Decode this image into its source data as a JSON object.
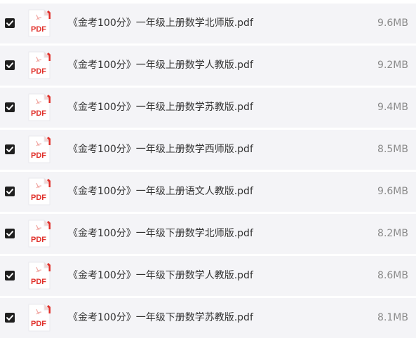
{
  "files": [
    {
      "name": "《金考100分》一年级上册数学北师版.pdf",
      "size": "9.6MB",
      "checked": true,
      "icon": "pdf-file-icon",
      "icon_label": "PDF"
    },
    {
      "name": "《金考100分》一年级上册数学人教版.pdf",
      "size": "9.2MB",
      "checked": true,
      "icon": "pdf-file-icon",
      "icon_label": "PDF"
    },
    {
      "name": "《金考100分》一年级上册数学苏教版.pdf",
      "size": "9.4MB",
      "checked": true,
      "icon": "pdf-file-icon",
      "icon_label": "PDF"
    },
    {
      "name": "《金考100分》一年级上册数学西师版.pdf",
      "size": "8.5MB",
      "checked": true,
      "icon": "pdf-file-icon",
      "icon_label": "PDF"
    },
    {
      "name": "《金考100分》一年级上册语文人教版.pdf",
      "size": "9.6MB",
      "checked": true,
      "icon": "pdf-file-icon",
      "icon_label": "PDF"
    },
    {
      "name": "《金考100分》一年级下册数学北师版.pdf",
      "size": "8.2MB",
      "checked": true,
      "icon": "pdf-file-icon",
      "icon_label": "PDF"
    },
    {
      "name": "《金考100分》一年级下册数学人教版.pdf",
      "size": "8.6MB",
      "checked": true,
      "icon": "pdf-file-icon",
      "icon_label": "PDF"
    },
    {
      "name": "《金考100分》一年级下册数学苏教版.pdf",
      "size": "8.1MB",
      "checked": true,
      "icon": "pdf-file-icon",
      "icon_label": "PDF"
    }
  ],
  "colors": {
    "row_background": "#f4f4f7",
    "checkbox": "#1f1f1f",
    "pdf_red": "#e0312b",
    "text": "#333333",
    "size_text": "#8a8a8a"
  }
}
